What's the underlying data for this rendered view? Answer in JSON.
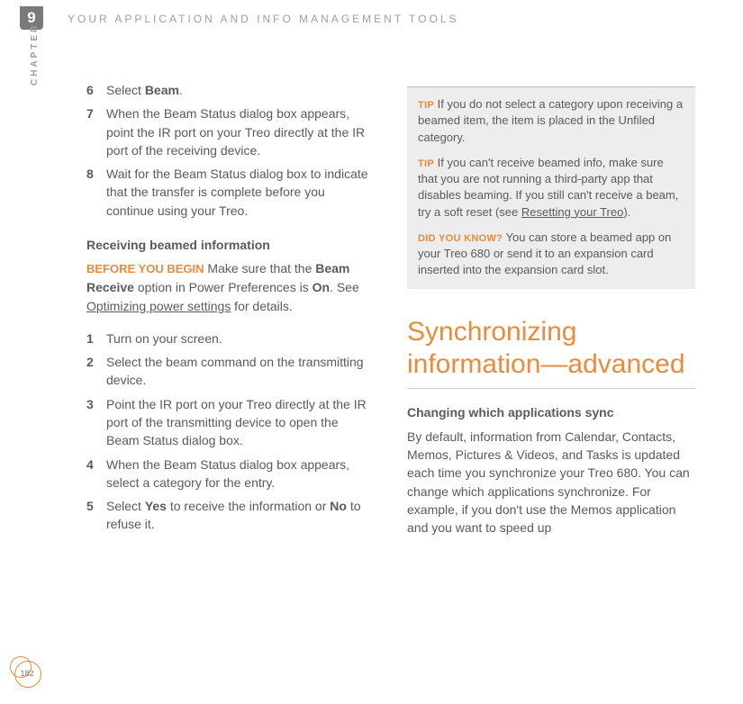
{
  "chapter": {
    "number": "9",
    "label": "CHAPTER"
  },
  "section_title": "YOUR APPLICATION AND INFO MANAGEMENT TOOLS",
  "left": {
    "stepsA": [
      {
        "n": "6",
        "pre": "Select ",
        "bold": "Beam",
        "post": "."
      },
      {
        "n": "7",
        "text": "When the Beam Status dialog box appears, point the IR port on your Treo directly at the IR port of the receiving device."
      },
      {
        "n": "8",
        "text": "Wait for the Beam Status dialog box to indicate that the transfer is complete before you continue using your Treo."
      }
    ],
    "sub_heading": "Receiving beamed information",
    "before": {
      "label": "BEFORE YOU BEGIN",
      "t1": "  Make sure that the ",
      "b1": "Beam Receive",
      "t2": " option in Power Preferences is ",
      "b2": "On",
      "t3": ". See ",
      "link": "Optimizing power settings",
      "t4": " for details."
    },
    "stepsB": [
      {
        "n": "1",
        "text": "Turn on your screen."
      },
      {
        "n": "2",
        "text": "Select the beam command on the transmitting device."
      },
      {
        "n": "3",
        "text": "Point the IR port on your Treo directly at the IR port of the transmitting device to open the Beam Status dialog box."
      },
      {
        "n": "4",
        "text": "When the Beam Status dialog box appears, select a category for the entry."
      },
      {
        "n": "5",
        "pre": "Select ",
        "bold": "Yes",
        "mid": " to receive the information or ",
        "bold2": "No",
        "post": " to refuse it."
      }
    ]
  },
  "right": {
    "tips": {
      "tip_label": "TIP",
      "tip1": "If you do not select a category upon receiving a beamed item, the item is placed in the Unfiled category.",
      "tip2a": "If you can't receive beamed info, make sure that you are not running a third-party app that disables beaming. If you still can't receive a beam, try a soft reset (see ",
      "tip2_link": "Resetting your Treo",
      "tip2b": ").",
      "dyk_label": "DID YOU KNOW?",
      "dyk": "You can store a beamed app on your Treo 680 or send it to an expansion card inserted into the expansion card slot."
    },
    "heading": "Synchronizing information—advanced",
    "sub_heading": "Changing which applications sync",
    "body": "By default, information from Calendar, Contacts, Memos, Pictures & Videos, and Tasks is updated each time you synchronize your Treo 680.   You can change which applications synchronize. For example, if you don't use the Memos application and you want to speed up"
  },
  "page_number": "182"
}
